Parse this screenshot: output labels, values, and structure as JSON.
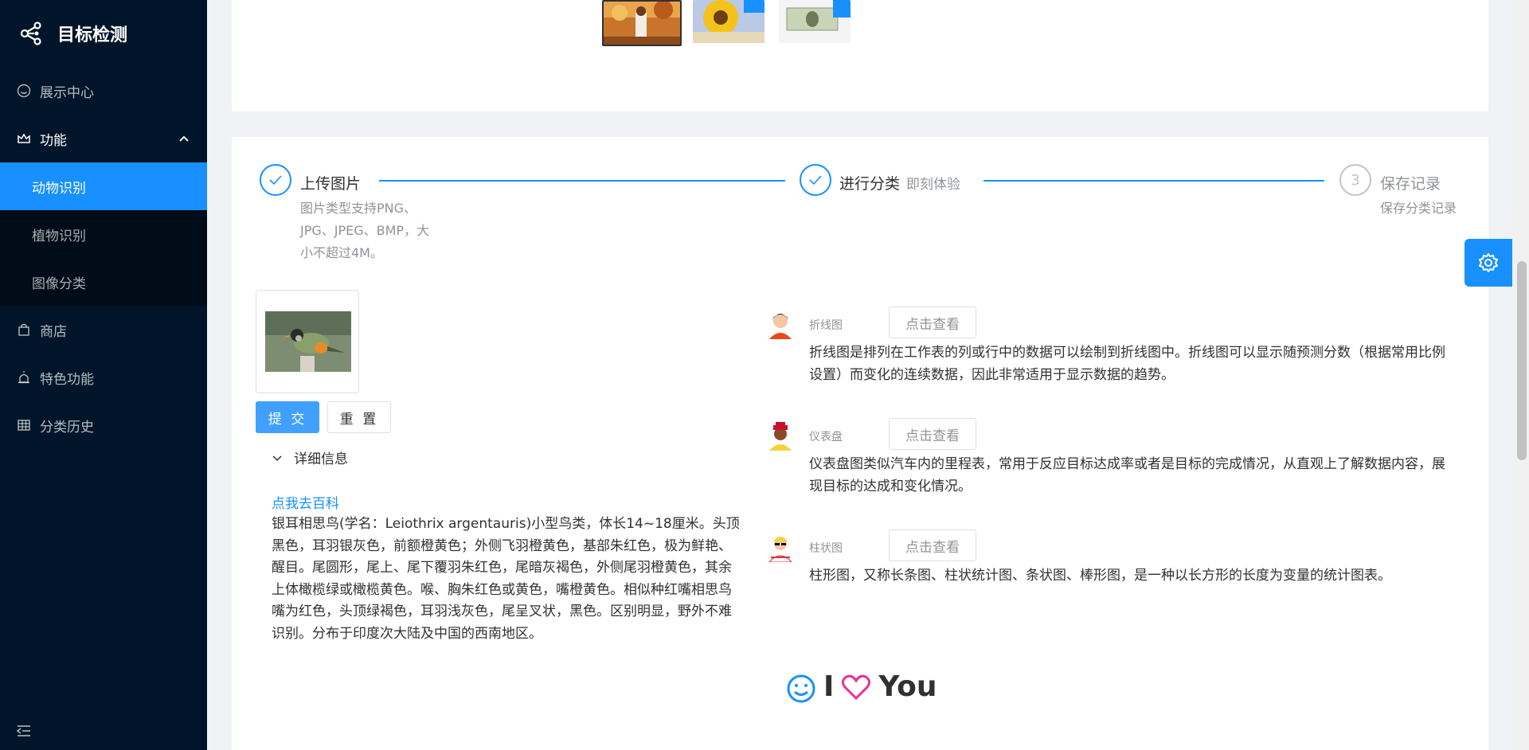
{
  "sidebar": {
    "app_title": "目标检测",
    "menu": [
      {
        "label": "展示中心"
      },
      {
        "label": "功能"
      },
      {
        "label": "商店"
      },
      {
        "label": "特色功能"
      },
      {
        "label": "分类历史"
      }
    ],
    "submenu": [
      {
        "label": "动物识别",
        "active": true
      },
      {
        "label": "植物识别"
      },
      {
        "label": "图像分类"
      }
    ]
  },
  "steps": [
    {
      "title": "上传图片",
      "description": "图片类型支持PNG、JPG、JPEG、BMP，大小不超过4M。",
      "desc_lines": [
        "图片类型支持PNG、",
        "JPG、JPEG、BMP，大",
        "小不超过4M。"
      ]
    },
    {
      "title": "进行分类",
      "subtitle": "即刻体验"
    },
    {
      "number": "3",
      "title": "保存记录",
      "description": "保存分类记录"
    }
  ],
  "actions": {
    "submit": "提 交",
    "reset": "重 置"
  },
  "details": {
    "header": "详细信息",
    "link": "点我去百科",
    "text": "银耳相思鸟(学名：Leiothrix argentauris)小型鸟类，体长14~18厘米。头顶黑色，耳羽银灰色，前额橙黄色；外侧飞羽橙黄色，基部朱红色，极为鲜艳、醒目。尾圆形，尾上、尾下覆羽朱红色，尾暗灰褐色，外侧尾羽橙黄色，其余上体橄榄绿或橄榄黄色。喉、胸朱红色或黄色，嘴橙黄色。相似种红嘴相思鸟嘴为红色，头顶绿褐色，耳羽浅灰色，尾呈叉状，黑色。区别明显，野外不难识别。分布于印度次大陆及中国的西南地区。"
  },
  "charts": [
    {
      "label": "折线图",
      "button": "点击查看",
      "description": "折线图是排列在工作表的列或行中的数据可以绘制到折线图中。折线图可以显示随预测分数（根据常用比例设置）而变化的连续数据，因此非常适用于显示数据的趋势。"
    },
    {
      "label": "仪表盘",
      "button": "点击查看",
      "description": "仪表盘图类似汽车内的里程表，常用于反应目标达成率或者是目标的完成情况，从直观上了解数据内容，展现目标的达成和变化情况。"
    },
    {
      "label": "柱状图",
      "button": "点击查看",
      "description": "柱形图，又称长条图、柱状统计图、条状图、棒形图，是一种以长方形的长度为变量的统计图表。"
    }
  ],
  "footer": {
    "word1": "I",
    "word2": "You"
  },
  "colors": {
    "primary": "#1890ff",
    "sidebar_bg": "#001529",
    "heart": "#eb2f96"
  }
}
